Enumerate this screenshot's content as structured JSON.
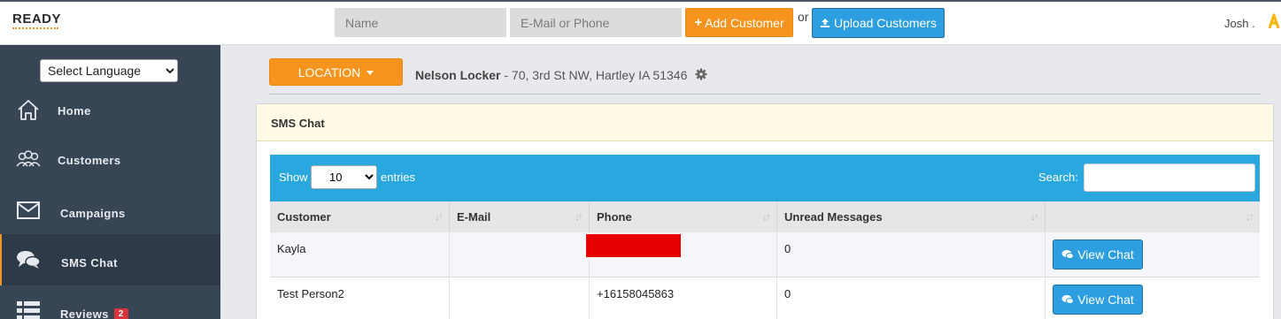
{
  "header": {
    "logo_text": "READY",
    "name_placeholder": "Name",
    "contact_placeholder": "E-Mail or Phone",
    "add_customer_label": "Add Customer",
    "or_text": "or",
    "upload_customers_label": "Upload Customers",
    "user_name": "Josh ."
  },
  "sidebar": {
    "language_select": "Select Language",
    "items": [
      {
        "label": "Home",
        "icon": "home-icon"
      },
      {
        "label": "Customers",
        "icon": "users-icon"
      },
      {
        "label": "Campaigns",
        "icon": "envelope-icon"
      },
      {
        "label": "SMS Chat",
        "icon": "chat-icon",
        "active": true
      },
      {
        "label": "Reviews",
        "icon": "list-icon",
        "badge": "2"
      }
    ]
  },
  "location": {
    "button_label": "LOCATION",
    "name": "Nelson Locker",
    "address": " - 70, 3rd St NW, Hartley IA 51346"
  },
  "panel": {
    "title": "SMS Chat"
  },
  "table": {
    "show_label": "Show",
    "entries_value": "10",
    "entries_label": "entries",
    "search_label": "Search:",
    "columns": [
      "Customer",
      "E-Mail",
      "Phone",
      "Unread Messages",
      ""
    ],
    "rows": [
      {
        "customer": "Kayla",
        "email": "",
        "phone": "",
        "unread": "0",
        "action": "View Chat"
      },
      {
        "customer": "Test Person2",
        "email": "",
        "phone": "+16158045863",
        "unread": "0",
        "action": "View Chat"
      }
    ]
  },
  "colors": {
    "accent_orange": "#f7941d",
    "accent_blue": "#29a8e0",
    "sidebar_bg": "#384555",
    "redaction": "#e60000"
  }
}
